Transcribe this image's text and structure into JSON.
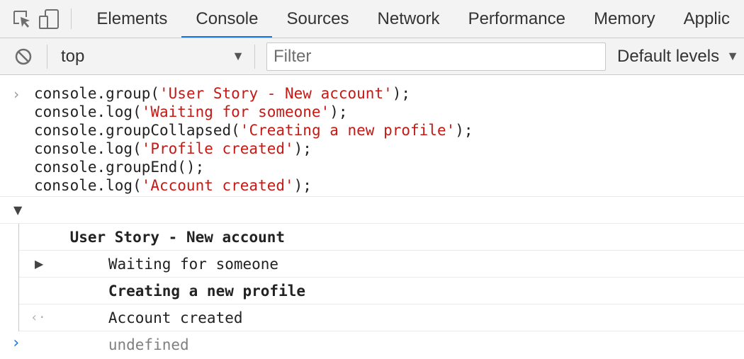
{
  "tabs": [
    "Elements",
    "Console",
    "Sources",
    "Network",
    "Performance",
    "Memory",
    "Applic"
  ],
  "active_tab": "Console",
  "toolbar": {
    "context": "top",
    "filter_placeholder": "Filter",
    "levels": "Default levels"
  },
  "input_code": [
    {
      "pre": "console.group(",
      "str": "'User Story - New account'",
      "post": ");"
    },
    {
      "pre": "console.log(",
      "str": "'Waiting for someone'",
      "post": ");"
    },
    {
      "pre": "console.groupCollapsed(",
      "str": "'Creating a new profile'",
      "post": ");"
    },
    {
      "pre": "console.log(",
      "str": "'Profile created'",
      "post": ");"
    },
    {
      "pre": "console.groupEnd();",
      "str": "",
      "post": ""
    },
    {
      "pre": "console.log(",
      "str": "'Account created'",
      "post": ");"
    }
  ],
  "output": {
    "group_title": "User Story - New account",
    "log_waiting": "Waiting for someone",
    "collapsed_group_title": "Creating a new profile",
    "log_account": "Account created",
    "result": "undefined"
  },
  "colors": {
    "accent": "#1a73e8",
    "string": "#c41a16"
  }
}
